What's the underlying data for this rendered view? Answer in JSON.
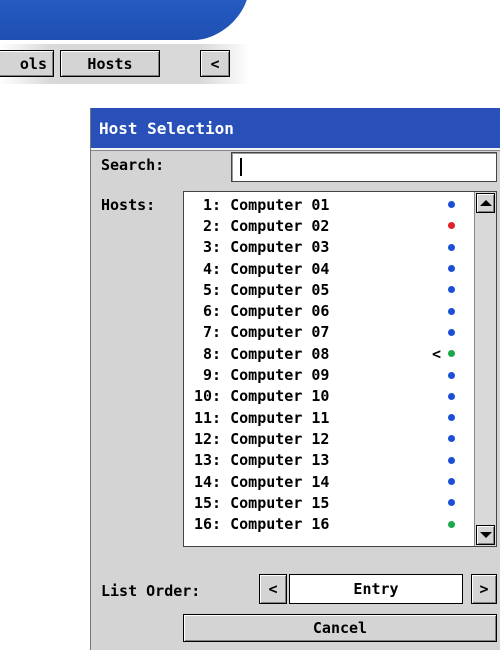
{
  "tabs": {
    "tools_label": "ols",
    "hosts_label": "Hosts",
    "prev_label": "<"
  },
  "dialog": {
    "title": "Host Selection",
    "search_label": "Search:",
    "search_value": "",
    "hosts_label": "Hosts:",
    "selected_marker": "<",
    "hosts": [
      {
        "label": " 1: Computer 01",
        "status": "blue"
      },
      {
        "label": " 2: Computer 02",
        "status": "red"
      },
      {
        "label": " 3: Computer 03",
        "status": "blue"
      },
      {
        "label": " 4: Computer 04",
        "status": "blue"
      },
      {
        "label": " 5: Computer 05",
        "status": "blue"
      },
      {
        "label": " 6: Computer 06",
        "status": "blue"
      },
      {
        "label": " 7: Computer 07",
        "status": "blue"
      },
      {
        "label": " 8: Computer 08",
        "status": "green",
        "selected": true
      },
      {
        "label": " 9: Computer 09",
        "status": "blue"
      },
      {
        "label": "10: Computer 10",
        "status": "blue"
      },
      {
        "label": "11: Computer 11",
        "status": "blue"
      },
      {
        "label": "12: Computer 12",
        "status": "blue"
      },
      {
        "label": "13: Computer 13",
        "status": "blue"
      },
      {
        "label": "14: Computer 14",
        "status": "blue"
      },
      {
        "label": "15: Computer 15",
        "status": "blue"
      },
      {
        "label": "16: Computer 16",
        "status": "green"
      }
    ],
    "list_order_label": "List Order:",
    "list_order_prev": "<",
    "list_order_value": "Entry",
    "list_order_next": ">",
    "cancel_label": "Cancel"
  },
  "colors": {
    "title_bg": "#2850b8",
    "status_blue": "#1a4fd6",
    "status_red": "#e0202a",
    "status_green": "#1aa84a"
  }
}
